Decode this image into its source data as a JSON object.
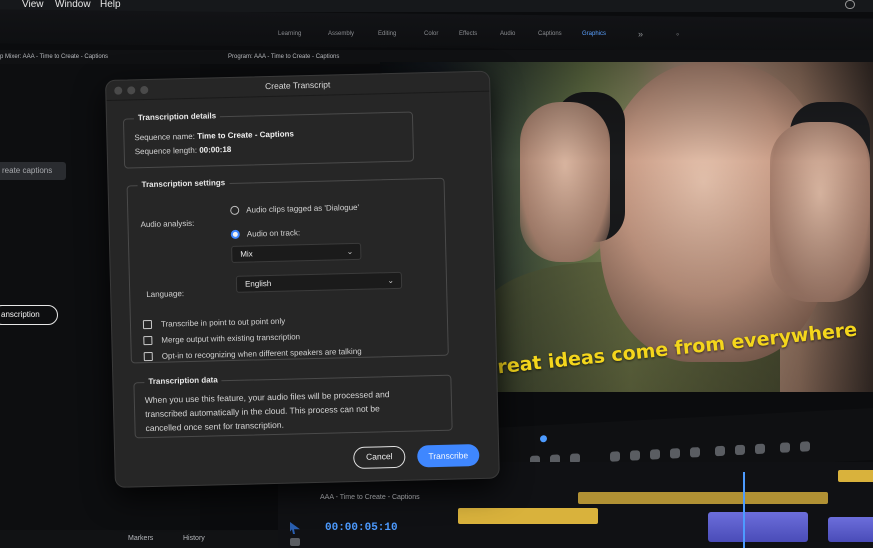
{
  "menubar": {
    "items": [
      "",
      "View",
      "Window",
      "Help"
    ]
  },
  "workspace": {
    "tabs": [
      {
        "label": "Learning"
      },
      {
        "label": "Assembly"
      },
      {
        "label": "Editing"
      },
      {
        "label": "Color"
      },
      {
        "label": "Effects"
      },
      {
        "label": "Audio"
      },
      {
        "label": "Captions"
      },
      {
        "label": "Graphics",
        "active": true
      }
    ]
  },
  "panels": {
    "left_title": "p Mixer: AAA - Time to Create - Captions",
    "program_title": "Program: AAA - Time to Create - Captions"
  },
  "left": {
    "create_captions": "reate captions",
    "transcription_pill": "anscription"
  },
  "dialog": {
    "title": "Create Transcript",
    "details": {
      "legend": "Transcription details",
      "sequence_name_label": "Sequence name:",
      "sequence_name_value": "Time to Create - Captions",
      "sequence_length_label": "Sequence length:",
      "sequence_length_value": "00:00:18"
    },
    "settings": {
      "legend": "Transcription settings",
      "audio_analysis_label": "Audio analysis:",
      "option_dialogue": "Audio clips tagged as 'Dialogue'",
      "option_track": "Audio on track:",
      "track_select": "Mix",
      "language_label": "Language:",
      "language_select": "English",
      "checkbox_in_out": "Transcribe in point to out point only",
      "checkbox_merge": "Merge output with existing transcription",
      "checkbox_speakers": "Opt-in to recognizing when different speakers are talking"
    },
    "data": {
      "legend": "Transcription data",
      "line1": "When you use this feature, your audio files will be processed and",
      "line2": "transcribed automatically in the cloud. This process can not be",
      "line3": "cancelled once sent for transcription."
    },
    "cancel_label": "Cancel",
    "transcribe_label": "Transcribe"
  },
  "video": {
    "caption": "Great ideas come from everywhere"
  },
  "timeline": {
    "title": "AAA - Time to Create - Captions",
    "timecode": "00:00:05:10"
  },
  "bottom_tabs": [
    "Markers",
    "History"
  ],
  "colors": {
    "accent": "#3f87ff",
    "caption": "#f4d61c",
    "clip": "#d9b23c"
  }
}
